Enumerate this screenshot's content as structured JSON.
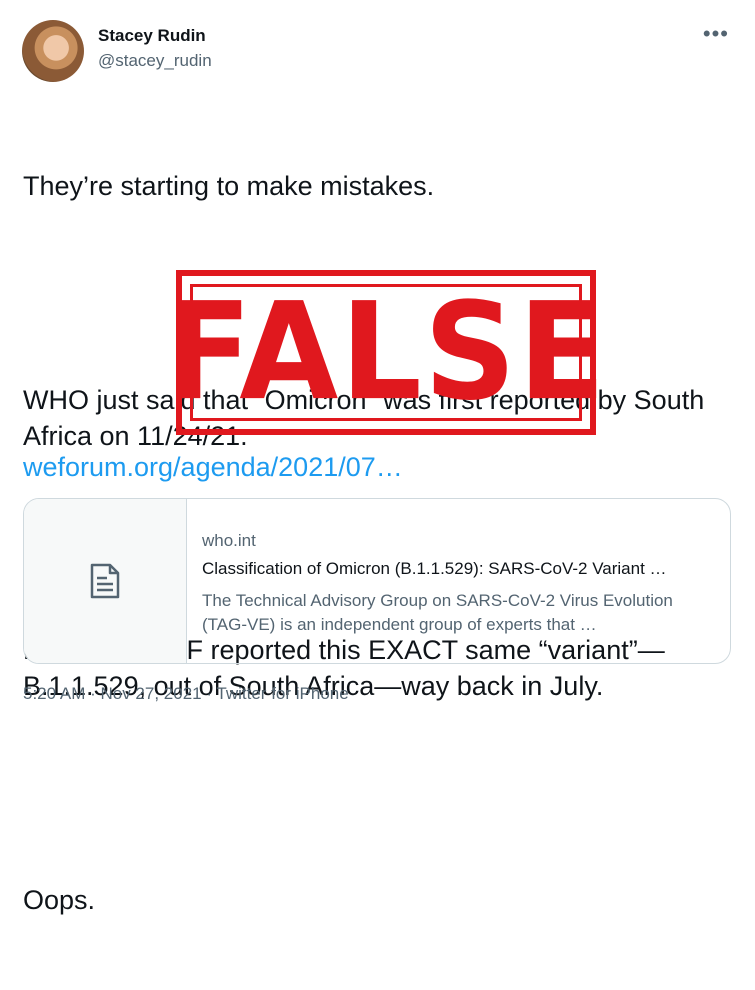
{
  "author": {
    "name": "Stacey Rudin",
    "handle": "@stacey_rudin"
  },
  "menu_icon": "more-horizontal-icon",
  "tweet": {
    "paragraphs": [
      "They’re starting to make mistakes.",
      "WHO just said that “Omicron” was first reported by South Africa on 11/24/21.",
      "However, WEF reported this EXACT same “variant”—B.1.1.529, out of South Africa—way back in July.",
      "Oops."
    ],
    "link_text": "weforum.org/agenda/2021/07…"
  },
  "card": {
    "icon": "document-icon",
    "domain": "who.int",
    "title": "Classification of Omicron (B.1.1.529): SARS-CoV-2 Variant …",
    "description": "The Technical Advisory Group on SARS-CoV-2 Virus Evolution (TAG-VE) is an independent group of experts that …"
  },
  "meta": {
    "text": "5:20 AM · Nov 27, 2021 · Twitter for iPhone"
  },
  "stamp": {
    "text": "FALSE",
    "color": "#e0181e"
  },
  "colors": {
    "link": "#1d9bf0",
    "secondary_text": "#536471"
  }
}
